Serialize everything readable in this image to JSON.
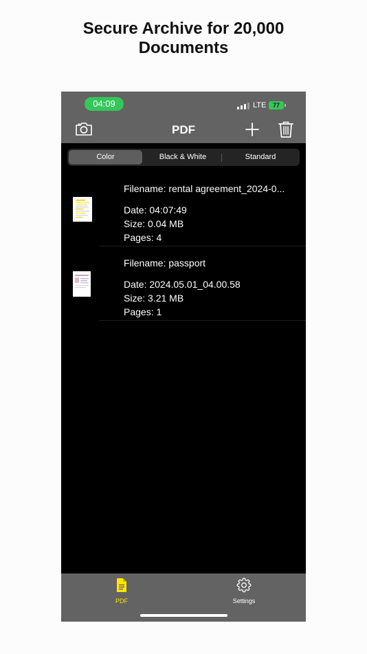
{
  "headline": {
    "line1": "Secure Archive for 20,000",
    "line2": "Documents"
  },
  "status_bar": {
    "time": "04:09",
    "network": "LTE",
    "battery": "77"
  },
  "nav": {
    "title": "PDF",
    "camera_icon": "camera-icon",
    "add_icon": "plus-icon",
    "delete_icon": "trash-icon"
  },
  "filter": {
    "options": [
      "Color",
      "Black & White",
      "Standard"
    ],
    "selected": "Color"
  },
  "documents": [
    {
      "filename": "Filename: rental agreement_2024-0...",
      "date": "Date: 04:07:49",
      "size": "Size: 0.04 MB",
      "pages": "Pages: 4"
    },
    {
      "filename": "Filename: passport",
      "date": "Date: 2024.05.01_04.00.58",
      "size": "Size: 3.21 MB",
      "pages": "Pages: 1"
    }
  ],
  "tabbar": {
    "pdf_label": "PDF",
    "settings_label": "Settings",
    "pdf_icon": "document-icon",
    "settings_icon": "gear-icon",
    "active_color": "#ffe600",
    "inactive_color": "#ffffff"
  },
  "colors": {
    "bar_background": "#636363",
    "status_pill": "#34c759",
    "content_background": "#000000"
  }
}
